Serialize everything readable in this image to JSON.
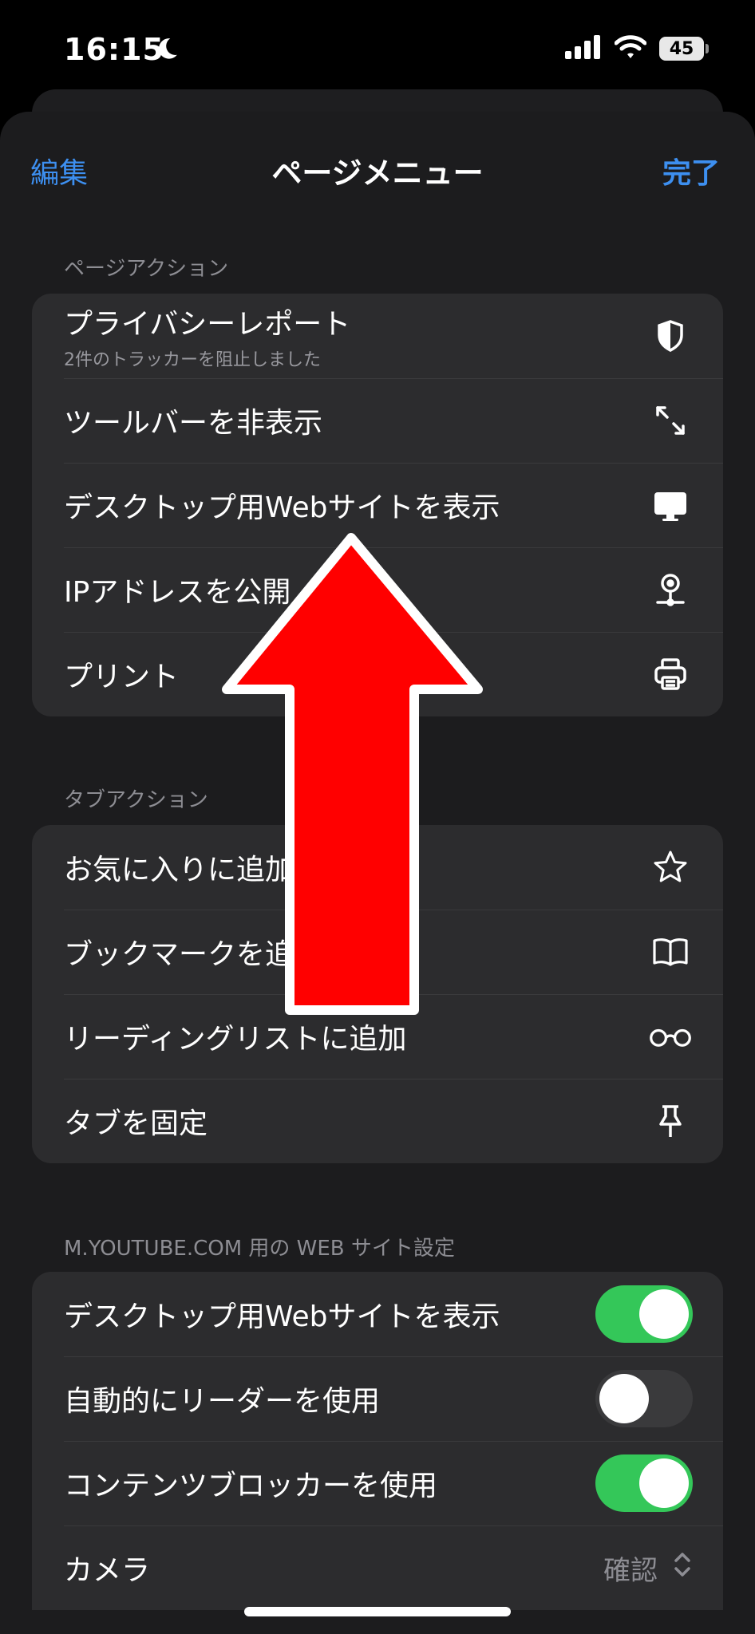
{
  "status_bar": {
    "time": "16:15",
    "battery": "45"
  },
  "nav": {
    "edit": "編集",
    "title": "ページメニュー",
    "done": "完了"
  },
  "page_actions": {
    "header": "ページアクション",
    "items": [
      {
        "label": "プライバシーレポート",
        "sub": "2件のトラッカーを阻止しました",
        "icon": "shield-icon"
      },
      {
        "label": "ツールバーを非表示",
        "icon": "expand-arrows-icon"
      },
      {
        "label": "デスクトップ用Webサイトを表示",
        "icon": "desktop-icon"
      },
      {
        "label": "IPアドレスを公開",
        "icon": "location-pin-icon"
      },
      {
        "label": "プリント",
        "icon": "printer-icon"
      }
    ]
  },
  "tab_actions": {
    "header": "タブアクション",
    "items": [
      {
        "label": "お気に入りに追加",
        "icon": "star-icon"
      },
      {
        "label": "ブックマークを追加",
        "icon": "book-icon"
      },
      {
        "label": "リーディングリストに追加",
        "icon": "glasses-icon"
      },
      {
        "label": "タブを固定",
        "icon": "pin-icon"
      }
    ]
  },
  "site_settings": {
    "header": "M.YOUTUBE.COM 用の WEB サイト設定",
    "items": [
      {
        "label": "デスクトップ用Webサイトを表示",
        "toggle": true
      },
      {
        "label": "自動的にリーダーを使用",
        "toggle": false
      },
      {
        "label": "コンテンツブロッカーを使用",
        "toggle": true
      },
      {
        "label": "カメラ",
        "value": "確認",
        "icon": "up-down-chevron-icon"
      }
    ]
  },
  "annotation": {
    "color": "#ff0000",
    "outline": "#ffffff",
    "icon": "red-up-arrow-icon"
  }
}
